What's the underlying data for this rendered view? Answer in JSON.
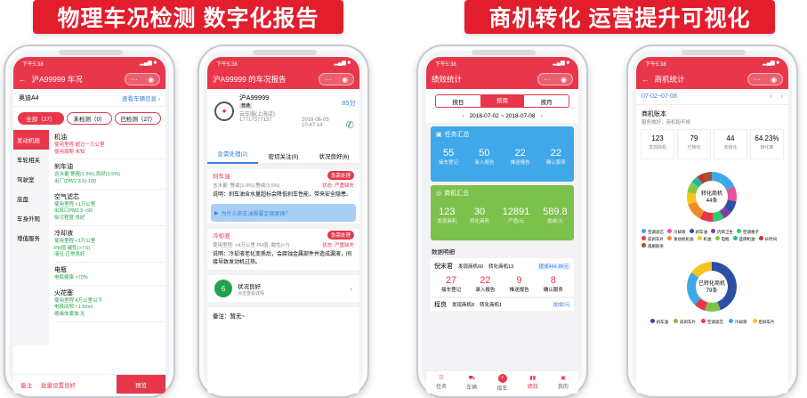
{
  "banners": {
    "left": "物理车况检测 数字化报告",
    "right": "商机转化 运营提升可视化"
  },
  "status": {
    "time": "下午5:38"
  },
  "p1": {
    "title": "沪A99999 车况",
    "car": "奥迪A4",
    "car_link": "查看车辆信息 ›",
    "filters": [
      "全部（27）",
      "未检测（0）",
      "已检测（27）"
    ],
    "side": [
      "发动机舱",
      "车轮相关",
      "驾驶室",
      "底盘",
      "车身外观",
      "增值服务"
    ],
    "items": [
      {
        "name": "机油",
        "lines": [
          [
            "使用里程 超过一万公里",
            "red"
          ],
          [
            "使用周期 未知",
            "red"
          ]
        ]
      },
      {
        "name": "刹车油",
        "lines": [
          [
            "含水量 警报(1.5%),良好(3.5%)",
            "grn"
          ],
          [
            "出厂(DW2 3.5)-100",
            "grn"
          ]
        ]
      },
      {
        "name": "空气滤芯",
        "lines": [
          [
            "使用里程 <1万公里",
            "grn"
          ],
          [
            "出风口PM2.5 <90",
            "grn"
          ],
          [
            "吸污程度 良好",
            "grn"
          ]
        ]
      },
      {
        "name": "冷却液",
        "lines": [
          [
            "使用里程 <1万公里",
            "grn"
          ],
          [
            "PH值 碱性(>7.5)",
            "grn"
          ],
          [
            "液位 正常良好",
            "grn"
          ]
        ]
      },
      {
        "name": "电瓶",
        "lines": [
          [
            "电瓶健康 >70%",
            "grn"
          ]
        ]
      },
      {
        "name": "火花塞",
        "lines": [
          [
            "使用里程 4万公里以下",
            "grn"
          ],
          [
            "电极间隙 <1.5mm",
            "grn"
          ],
          [
            "绝缘体腐蚀 无",
            "grn"
          ]
        ]
      }
    ],
    "bottom": {
      "note": "备注",
      "remark": "批量设置良好",
      "btn": "预览"
    }
  },
  "p2": {
    "title": "沪A99999 的车况报告",
    "plate": "沪A99999",
    "badge": "普通",
    "shop": "云车服(上海店)",
    "phone": "17717377137",
    "date": "2018-06-05",
    "time": "10:47:14",
    "score": "85分",
    "tabs": [
      "急需处理(2)",
      "密切关注(0)",
      "状况良好(6)"
    ],
    "sections": [
      {
        "name": "刹车油",
        "btn": "急需处理",
        "meta": "含水量: 警戒(1.9%),警戒(3.5%)",
        "status": "状态: 严重缺失",
        "desc": "说明：刹车油含水量超标会降低刹车性能，带来安全隐患。"
      },
      {
        "name": "冷却液",
        "btn": "急需处理",
        "meta": "使用里程: >4万公里  PH值: 酸性(<7)",
        "status": "状态: 严重缺失",
        "desc": "说明：冷却液老化变质后，会腐蚀金属部件并造成漏液，间接导致发动机过热。"
      }
    ],
    "bluebar": "为什么刹车油需要定期更换？",
    "good": {
      "count": "6",
      "title": "状况良好",
      "sub": "点击查看详情"
    },
    "footer": "备注：暂无~"
  },
  "p3": {
    "title": "绩效统计",
    "tabs": [
      "按日",
      "按周",
      "按月"
    ],
    "range": "2018-07-02 ~ 2018-07-08",
    "task": {
      "title": "任务汇总",
      "vals": [
        "55",
        "50",
        "22",
        "22"
      ],
      "labels": [
        "接车登记",
        "录入报告",
        "推送报告",
        "确认服务"
      ]
    },
    "biz": {
      "title": "商机汇总",
      "vals": [
        "123",
        "30",
        "12891",
        "589.8"
      ],
      "labels": [
        "发现商机",
        "转化商机",
        "产值/元",
        "提成/元"
      ]
    },
    "detail": "数据明细",
    "person": {
      "name": "倪宋君",
      "a": "发现商机60",
      "b": "转化商机13",
      "c": "提成464.88元"
    },
    "pvals": [
      "27",
      "22",
      "9",
      "8"
    ],
    "plabels": [
      "接车登记",
      "录入报告",
      "推送报告",
      "确认服务"
    ],
    "person2": {
      "name": "程良",
      "a": "发现商机8",
      "b": "转化商机1",
      "c": "提成0元"
    },
    "tabbar": [
      "任务",
      "车辆",
      "接车",
      "绩效",
      "我的"
    ]
  },
  "p4": {
    "title": "商机统计",
    "week": "07-02~07-08",
    "acc": "商机账本",
    "acc_sub": "服务做好，商机跑不掉",
    "stats": [
      {
        "v": "123",
        "l": "发现商机"
      },
      {
        "v": "79",
        "l": "已转化"
      },
      {
        "v": "44",
        "l": "未转化"
      },
      {
        "v": "64.23%",
        "l": "转化率"
      }
    ],
    "donut1": {
      "title": "转化商机",
      "count": "44条"
    },
    "legend1": [
      "空调滤芯",
      "冷却液",
      "刹车油",
      "内饰卫生",
      "空调格子",
      "前刹车片",
      "发动机机油",
      "机油",
      "电瓶",
      "蓝牌机油",
      "长时间",
      "雨刷胶条"
    ],
    "donut2": {
      "title": "已转化商机",
      "count": "79条"
    },
    "legend2": [
      "刹车油",
      "前刹车片",
      "空调滤芯",
      "冷却液",
      "后刹车片"
    ]
  }
}
